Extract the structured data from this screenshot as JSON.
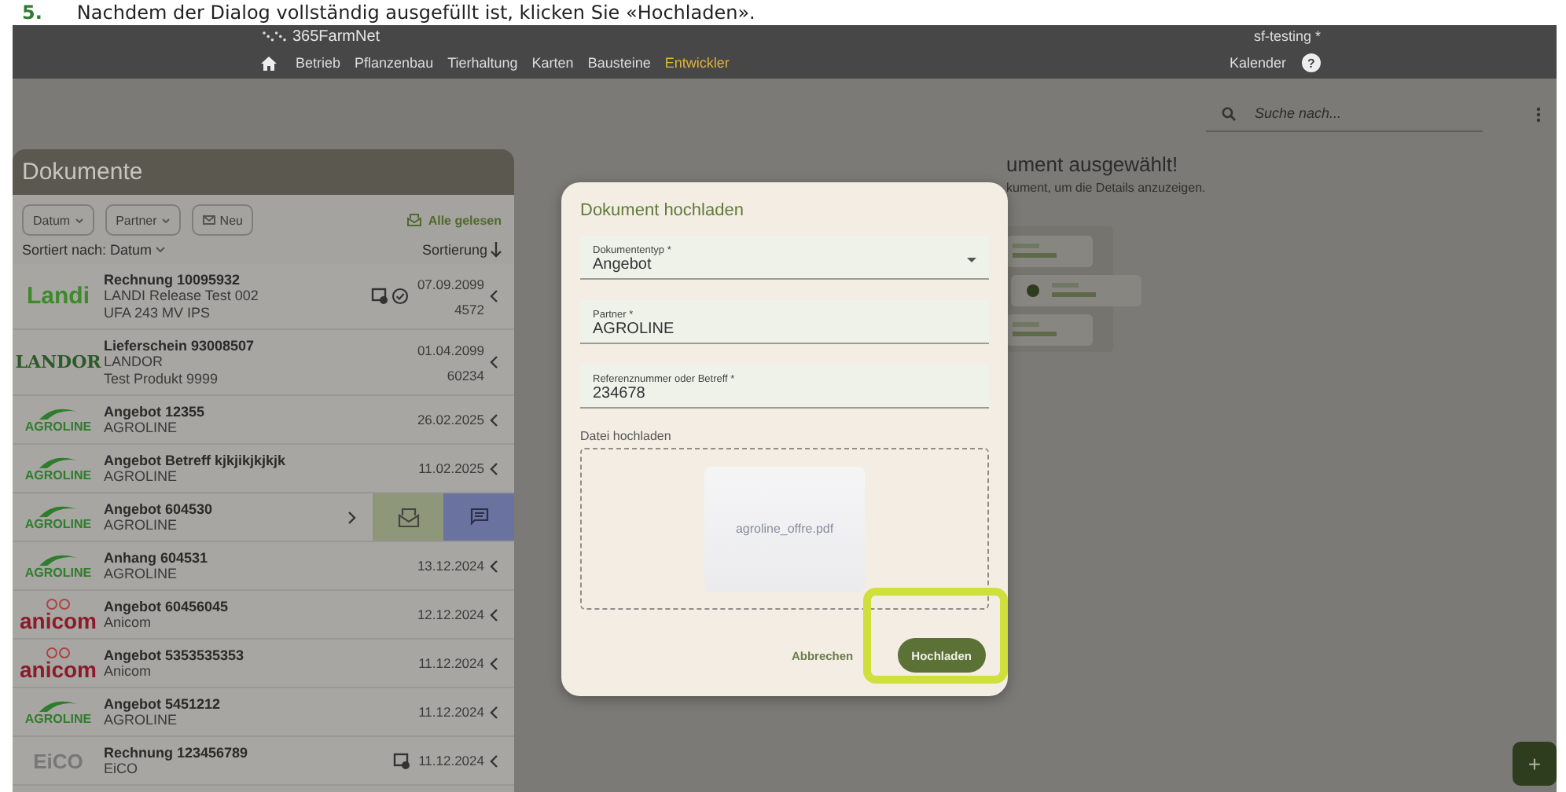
{
  "caption": {
    "number": "5.",
    "text": "Nachdem der Dialog vollständig ausgefüllt ist, klicken Sie «Hochladen»."
  },
  "header": {
    "logo": "365FarmNet",
    "user": "sf-testing *",
    "calendar": "Kalender",
    "help": "?",
    "nav": [
      {
        "label": "Betrieb",
        "selected": false
      },
      {
        "label": "Pflanzenbau",
        "selected": false
      },
      {
        "label": "Tierhaltung",
        "selected": false
      },
      {
        "label": "Karten",
        "selected": false
      },
      {
        "label": "Bausteine",
        "selected": false
      },
      {
        "label": "Entwickler",
        "selected": true
      }
    ]
  },
  "search": {
    "placeholder": "Suche nach..."
  },
  "documents": {
    "title": "Dokumente",
    "mark_all": "Alle gelesen",
    "sorted_by": "Sortiert nach: Datum",
    "sort": "Sortierung",
    "filters": [
      {
        "label": "Datum",
        "kind": "dropdown"
      },
      {
        "label": "Partner",
        "kind": "dropdown"
      },
      {
        "label": "Neu",
        "kind": "mail"
      }
    ],
    "rows": [
      {
        "kind": "detail",
        "logo": {
          "text": "Landi",
          "kind": "landi"
        },
        "title": "Rechnung 10095932",
        "partner": "LANDI Release Test 002",
        "line_3": "UFA 243 MV IPS",
        "date": "07.09.2099",
        "amount": "4572",
        "badges": [
          {
            "kind": "scan"
          },
          {
            "kind": "verified"
          }
        ]
      },
      {
        "kind": "detail",
        "logo": {
          "text": "LANDOR",
          "kind": "landor"
        },
        "title": "Lieferschein 93008507",
        "partner": "LANDOR",
        "line_3": "Test Produkt 9999",
        "date": "01.04.2099",
        "amount": "60234",
        "badges": []
      },
      {
        "kind": "simple",
        "logo": {
          "text": "AGROLINE",
          "kind": "agroline"
        },
        "title": "Angebot 12355",
        "partner": "AGROLINE",
        "date": "26.02.2025",
        "badges": []
      },
      {
        "kind": "simple",
        "logo": {
          "text": "AGROLINE",
          "kind": "agroline"
        },
        "title": "Angebot Betreff kjkjikjkjkjk",
        "partner": "AGROLINE",
        "date": "11.02.2025",
        "badges": []
      },
      {
        "kind": "swiped",
        "logo": {
          "text": "AGROLINE",
          "kind": "agroline"
        },
        "title": "Angebot 604530",
        "partner": "AGROLINE",
        "badges": []
      },
      {
        "kind": "simple",
        "logo": {
          "text": "AGROLINE",
          "kind": "agroline"
        },
        "title": "Anhang 604531",
        "partner": "AGROLINE",
        "date": "13.12.2024",
        "badges": []
      },
      {
        "kind": "simple",
        "logo": {
          "text": "anicom",
          "kind": "anicom"
        },
        "title": "Angebot 60456045",
        "partner": "Anicom",
        "date": "12.12.2024",
        "badges": []
      },
      {
        "kind": "simple",
        "logo": {
          "text": "anicom",
          "kind": "anicom"
        },
        "title": "Angebot 5353535353",
        "partner": "Anicom",
        "date": "11.12.2024",
        "badges": []
      },
      {
        "kind": "simple",
        "logo": {
          "text": "AGROLINE",
          "kind": "agroline"
        },
        "title": "Angebot 5451212",
        "partner": "AGROLINE",
        "date": "11.12.2024",
        "badges": []
      },
      {
        "kind": "simple",
        "logo": {
          "text": "EiCO",
          "kind": "eico"
        },
        "title": "Rechnung 123456789",
        "partner": "EiCO",
        "date": "11.12.2024",
        "badges": [
          {
            "kind": "scan"
          }
        ]
      }
    ]
  },
  "empty_state": {
    "title": "ument ausgewählt!",
    "text": "kument, um die Details anzuzeigen."
  },
  "dialog": {
    "title": "Dokument hochladen",
    "upload_label": "Datei hochladen",
    "file": "agroline_offre.pdf",
    "cancel": "Abbrechen",
    "submit": "Hochladen",
    "submit_highlighted": true,
    "fields": [
      {
        "label": "Dokumententyp *",
        "value": "Angebot",
        "kind": "select"
      },
      {
        "label": "Partner *",
        "value": "AGROLINE",
        "kind": "text"
      },
      {
        "label": "Referenznummer oder Betreff *",
        "value": "234678",
        "kind": "text"
      }
    ]
  },
  "fab": {
    "label": "+"
  }
}
